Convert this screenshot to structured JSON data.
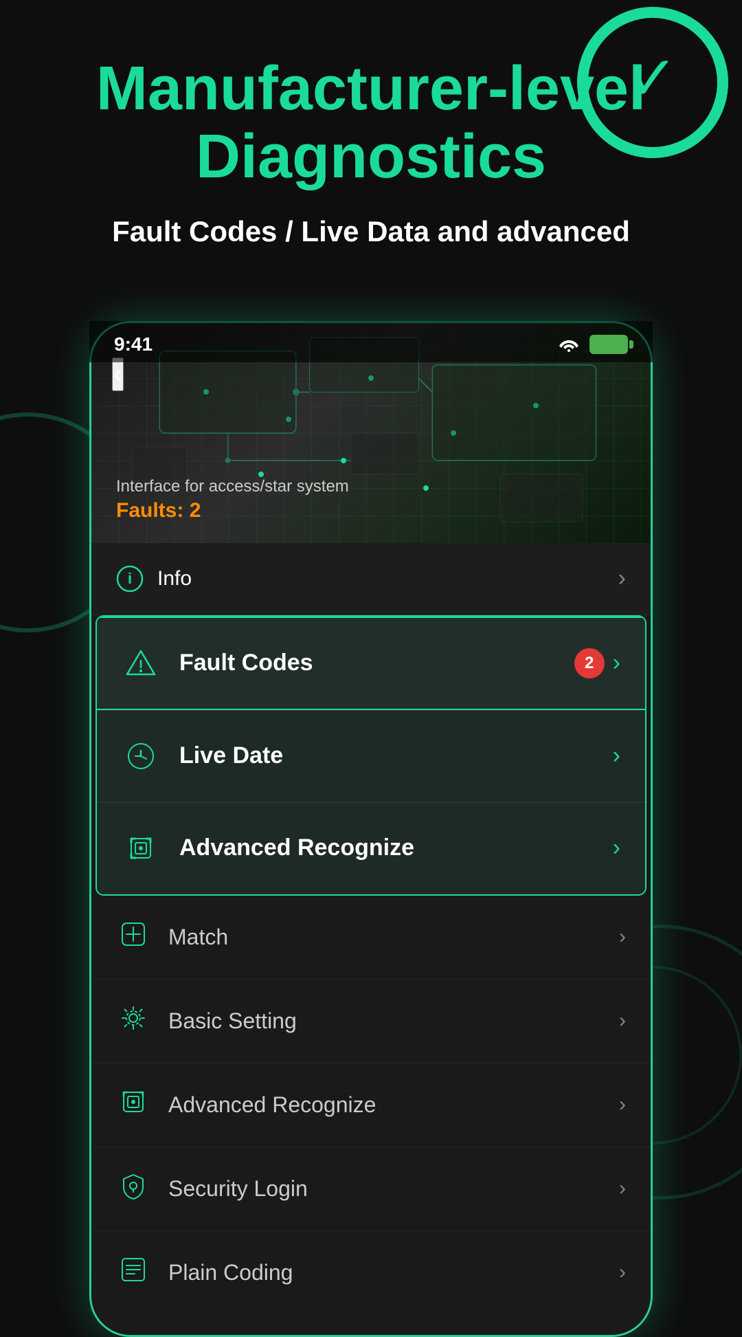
{
  "app": {
    "title": "Manufacturer-level Diagnostics",
    "subtitle": "Fault Codes / Live Data and advanced"
  },
  "statusBar": {
    "time": "9:41",
    "wifi": "wifi",
    "battery": "battery"
  },
  "hero": {
    "back_label": "‹",
    "interface_label": "Interface for access/star system",
    "faults_label": "Faults:",
    "faults_count": "2"
  },
  "info_item": {
    "label": "Info",
    "icon": "info"
  },
  "highlighted_items": [
    {
      "id": "fault-codes",
      "label": "Fault Codes",
      "badge": "2",
      "has_badge": true,
      "icon": "warning"
    },
    {
      "id": "live-date",
      "label": "Live Date",
      "has_badge": false,
      "icon": "chart"
    },
    {
      "id": "advanced-recognize-top",
      "label": "Advanced Recognize",
      "has_badge": false,
      "icon": "scan"
    }
  ],
  "bottom_items": [
    {
      "id": "match",
      "label": "Match",
      "icon": "match"
    },
    {
      "id": "basic-setting",
      "label": "Basic Setting",
      "icon": "gear"
    },
    {
      "id": "advanced-recognize",
      "label": "Advanced Recognize",
      "icon": "scan"
    },
    {
      "id": "security-login",
      "label": "Security Login",
      "icon": "shield"
    },
    {
      "id": "plain-coding",
      "label": "Plain Coding",
      "icon": "list"
    }
  ],
  "colors": {
    "accent": "#1adb9c",
    "bg": "#0e0e0e",
    "card": "#1a1a1a",
    "text": "#ffffff",
    "subtext": "#cccccc",
    "badge": "#e53935",
    "fault_count": "#ff8c00"
  }
}
